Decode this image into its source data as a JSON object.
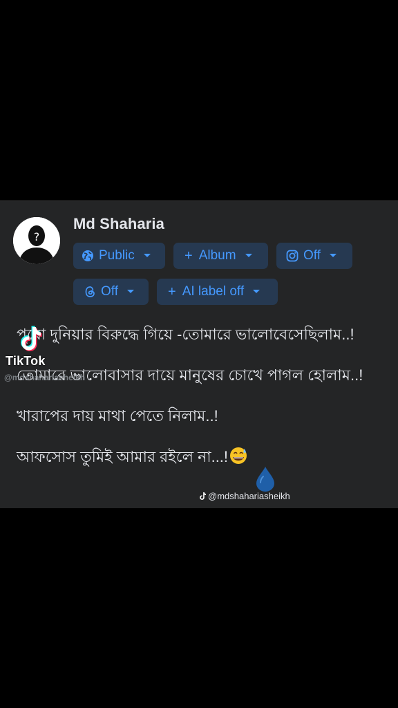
{
  "profile": {
    "name": "Md Shaharia"
  },
  "audience_pills": {
    "public": {
      "label": "Public",
      "icon": "globe-icon"
    },
    "album": {
      "label": "Album",
      "icon": "plus-icon"
    },
    "instagram": {
      "label": "Off",
      "icon": "instagram-icon"
    },
    "threads": {
      "label": "Off",
      "icon": "threads-icon"
    },
    "ai_label": {
      "label": "AI label off",
      "icon": "plus-icon"
    }
  },
  "post": {
    "lines": [
      "পুরো দুনিয়ার বিরুদ্ধে গিয়ে -তোমারে ভালোবেসেছিলাম..!",
      "তোমারে ভালোবাসার দায়ে মানুষের চোখে পাগল হোলাম..!",
      "খারাপের দায় মাথা পেতে নিলাম..!",
      "আফসোস তুমিই আমার রইলে না...!"
    ],
    "emoji": "grinning-sweat-emoji",
    "drop_icon": "blue-droplet-icon"
  },
  "watermark": {
    "brand": "TikTok",
    "handle_left": "@mdshahariasheikh",
    "handle_right": "@mdshahariasheikh"
  },
  "colors": {
    "background": "#000000",
    "card": "#242526",
    "pill_bg": "#263951",
    "pill_text": "#4599ff",
    "text": "#e4e6eb"
  }
}
